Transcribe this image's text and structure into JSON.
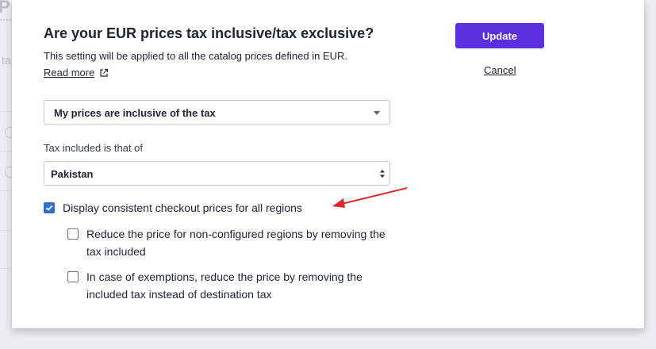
{
  "background": {
    "title_fragment": "P",
    "snippet_fragment": "ta"
  },
  "modal": {
    "title": "Are your EUR prices tax inclusive/tax exclusive?",
    "subtitle": "This setting will be applied to all the catalog prices defined in EUR.",
    "read_more_label": "Read more",
    "read_more_icon": "external-link-icon",
    "update_label": "Update",
    "cancel_label": "Cancel",
    "accent_color": "#5b2fe0",
    "tax_mode_select": {
      "value": "My prices are inclusive of the tax"
    },
    "tax_country": {
      "label": "Tax included is that of",
      "value": "Pakistan"
    },
    "options": {
      "consistent_prices": {
        "label": "Display consistent checkout prices for all regions",
        "checked": true
      },
      "reduce_non_configured": {
        "label": "Reduce the price for non-configured regions by removing the tax included",
        "checked": false
      },
      "exemptions": {
        "label": "In case of exemptions, reduce the price by removing the included tax instead of destination tax",
        "checked": false
      }
    },
    "annotation_arrow_color": "#e0262b"
  }
}
